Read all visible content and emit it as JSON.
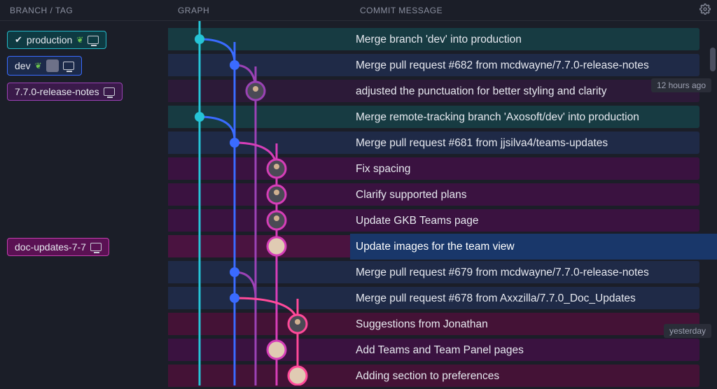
{
  "header": {
    "branch_label": "Branch / Tag",
    "graph_label": "Graph",
    "commit_label": "Commit Message"
  },
  "branches": {
    "production": "production",
    "dev": "dev",
    "release_notes": "7.7.0-release-notes",
    "doc_updates": "doc-updates-7-7"
  },
  "timestamps": {
    "hours_ago": "12 hours ago",
    "yesterday": "yesterday"
  },
  "commits": [
    {
      "msg": "Merge branch 'dev' into production"
    },
    {
      "msg": "Merge pull request #682 from mcdwayne/7.7.0-release-notes"
    },
    {
      "msg": "adjusted the punctuation for better styling and clarity"
    },
    {
      "msg": "Merge remote-tracking branch 'Axosoft/dev' into production"
    },
    {
      "msg": "Merge pull request #681 from jjsilva4/teams-updates"
    },
    {
      "msg": "Fix spacing"
    },
    {
      "msg": "Clarify supported plans"
    },
    {
      "msg": "Update GKB Teams page"
    },
    {
      "msg": "Update images for the team view"
    },
    {
      "msg": "Merge pull request #679 from mcdwayne/7.7.0-release-notes"
    },
    {
      "msg": "Merge pull request #678 from Axxzilla/7.7.0_Doc_Updates"
    },
    {
      "msg": "Suggestions from Jonathan"
    },
    {
      "msg": "Add Teams and Team Panel pages"
    },
    {
      "msg": "Adding section to preferences"
    }
  ],
  "colors": {
    "cyan": "#25c4d6",
    "blue": "#3a6bff",
    "purple": "#9b42b5",
    "magenta": "#d63eb8",
    "pink": "#ff4a99"
  }
}
